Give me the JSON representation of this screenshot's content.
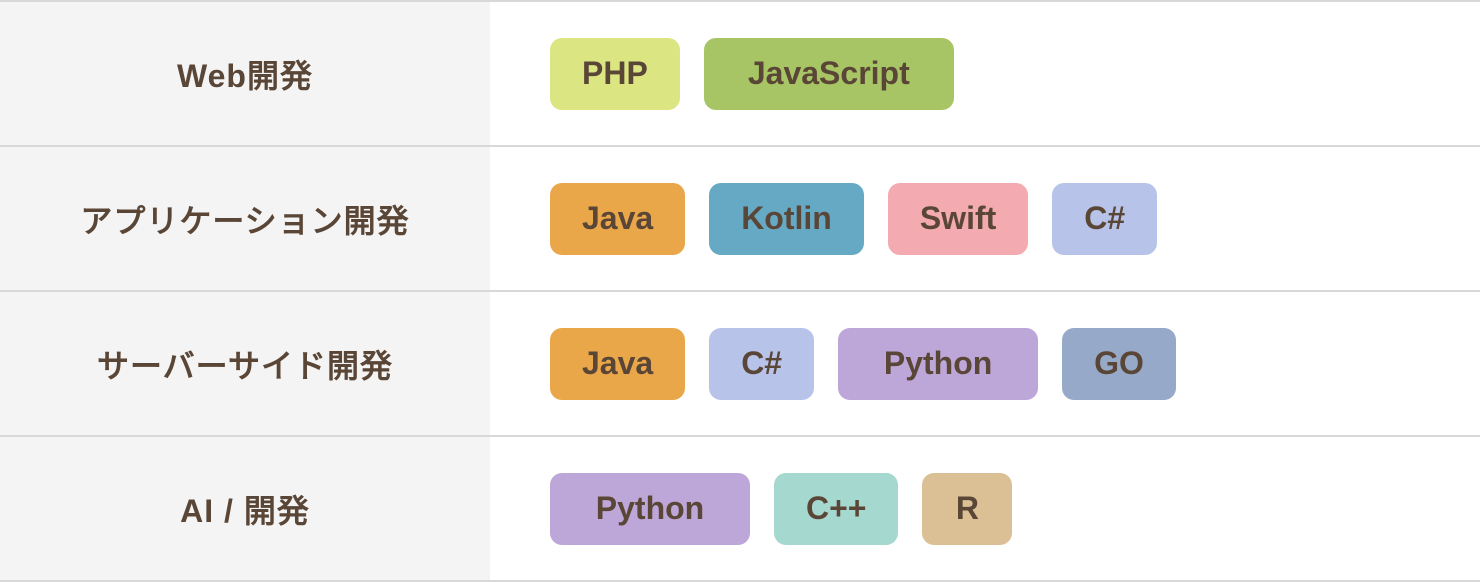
{
  "rows": [
    {
      "category": "Web開発",
      "tags": [
        {
          "label": "PHP",
          "classKey": "php"
        },
        {
          "label": "JavaScript",
          "classKey": "javascript"
        }
      ]
    },
    {
      "category": "アプリケーション開発",
      "tags": [
        {
          "label": "Java",
          "classKey": "java"
        },
        {
          "label": "Kotlin",
          "classKey": "kotlin"
        },
        {
          "label": "Swift",
          "classKey": "swift"
        },
        {
          "label": "C#",
          "classKey": "csharp"
        }
      ]
    },
    {
      "category": "サーバーサイド開発",
      "tags": [
        {
          "label": "Java",
          "classKey": "java"
        },
        {
          "label": "C#",
          "classKey": "csharp"
        },
        {
          "label": "Python",
          "classKey": "python"
        },
        {
          "label": "GO",
          "classKey": "go"
        }
      ]
    },
    {
      "category": "AI / 開発",
      "tags": [
        {
          "label": "Python",
          "classKey": "python"
        },
        {
          "label": "C++",
          "classKey": "cpp"
        },
        {
          "label": "R",
          "classKey": "r"
        }
      ]
    }
  ]
}
